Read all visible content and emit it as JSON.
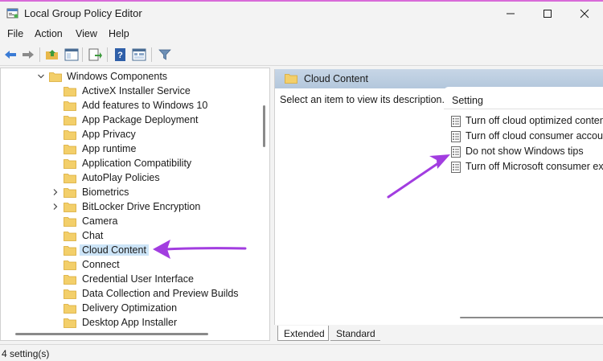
{
  "window": {
    "title": "Local Group Policy Editor"
  },
  "menu": {
    "items": [
      "File",
      "Action",
      "View",
      "Help"
    ]
  },
  "toolbar": {
    "icons": [
      "back-arrow-icon",
      "forward-arrow-icon",
      "up-folder-icon",
      "show-hide-tree-icon",
      "export-list-icon",
      "help-icon",
      "properties-icon",
      "filter-icon"
    ]
  },
  "tree": {
    "root": {
      "label": "Windows Components",
      "expanded": true
    },
    "items": [
      {
        "label": "ActiveX Installer Service",
        "expandable": false,
        "selected": false
      },
      {
        "label": "Add features to Windows 10",
        "expandable": false,
        "selected": false
      },
      {
        "label": "App Package Deployment",
        "expandable": false,
        "selected": false
      },
      {
        "label": "App Privacy",
        "expandable": false,
        "selected": false
      },
      {
        "label": "App runtime",
        "expandable": false,
        "selected": false
      },
      {
        "label": "Application Compatibility",
        "expandable": false,
        "selected": false
      },
      {
        "label": "AutoPlay Policies",
        "expandable": false,
        "selected": false
      },
      {
        "label": "Biometrics",
        "expandable": true,
        "selected": false
      },
      {
        "label": "BitLocker Drive Encryption",
        "expandable": true,
        "selected": false
      },
      {
        "label": "Camera",
        "expandable": false,
        "selected": false
      },
      {
        "label": "Chat",
        "expandable": false,
        "selected": false
      },
      {
        "label": "Cloud Content",
        "expandable": false,
        "selected": true
      },
      {
        "label": "Connect",
        "expandable": false,
        "selected": false
      },
      {
        "label": "Credential User Interface",
        "expandable": false,
        "selected": false
      },
      {
        "label": "Data Collection and Preview Builds",
        "expandable": false,
        "selected": false
      },
      {
        "label": "Delivery Optimization",
        "expandable": false,
        "selected": false
      },
      {
        "label": "Desktop App Installer",
        "expandable": false,
        "selected": false
      }
    ]
  },
  "details": {
    "title": "Cloud Content",
    "description": "Select an item to view its description.",
    "column_header": "Setting",
    "settings": [
      "Turn off cloud optimized content",
      "Turn off cloud consumer account state content",
      "Do not show Windows tips",
      "Turn off Microsoft consumer experiences"
    ]
  },
  "tabs": {
    "extended": "Extended",
    "standard": "Standard",
    "active": "Extended"
  },
  "status": {
    "text": "4 setting(s)"
  },
  "colors": {
    "accent_arrow": "#a23de0",
    "selection": "#cce4f7",
    "folder": "#f0c75a",
    "header_band": "#c2d3e4"
  }
}
